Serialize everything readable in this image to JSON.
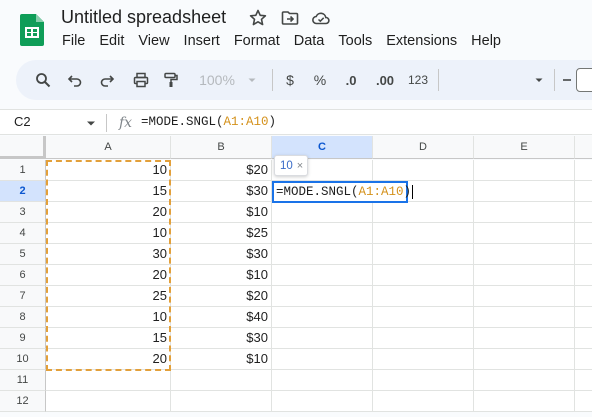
{
  "app": {
    "title": "Untitled spreadsheet",
    "menu": [
      "File",
      "Edit",
      "View",
      "Insert",
      "Format",
      "Data",
      "Tools",
      "Extensions",
      "Help"
    ]
  },
  "toolbar": {
    "zoom": "100%",
    "currency": "$",
    "percent": "%",
    "decrease_decimal": ".0",
    "increase_decimal": ".00",
    "format_number": "123"
  },
  "formula_bar": {
    "cell_ref": "C2",
    "fx": "fx",
    "formula_prefix": "=MODE.SNGL(",
    "formula_range": "A1:A10",
    "formula_suffix": ")"
  },
  "grid": {
    "columns": [
      "A",
      "B",
      "C",
      "D",
      "E"
    ],
    "selected_column": "C",
    "selected_row": 2,
    "rows": [
      {
        "num": "1",
        "a": "10",
        "b": "$20"
      },
      {
        "num": "2",
        "a": "15",
        "b": "$30"
      },
      {
        "num": "3",
        "a": "20",
        "b": "$10"
      },
      {
        "num": "4",
        "a": "10",
        "b": "$25"
      },
      {
        "num": "5",
        "a": "30",
        "b": "$30"
      },
      {
        "num": "6",
        "a": "20",
        "b": "$10"
      },
      {
        "num": "7",
        "a": "25",
        "b": "$20"
      },
      {
        "num": "8",
        "a": "10",
        "b": "$40"
      },
      {
        "num": "9",
        "a": "15",
        "b": "$30"
      },
      {
        "num": "10",
        "a": "20",
        "b": "$10"
      },
      {
        "num": "11",
        "a": "",
        "b": ""
      },
      {
        "num": "12",
        "a": "",
        "b": ""
      }
    ],
    "active_cell_formula_prefix": "=MODE.SNGL(",
    "active_cell_formula_range": "A1:A10",
    "active_cell_formula_suffix": ")",
    "preview_value": "10",
    "preview_close": "×"
  },
  "colors": {
    "selection": "#1a73e8",
    "range_highlight": "#e3a03a",
    "header_selected": "#d3e3fd"
  }
}
